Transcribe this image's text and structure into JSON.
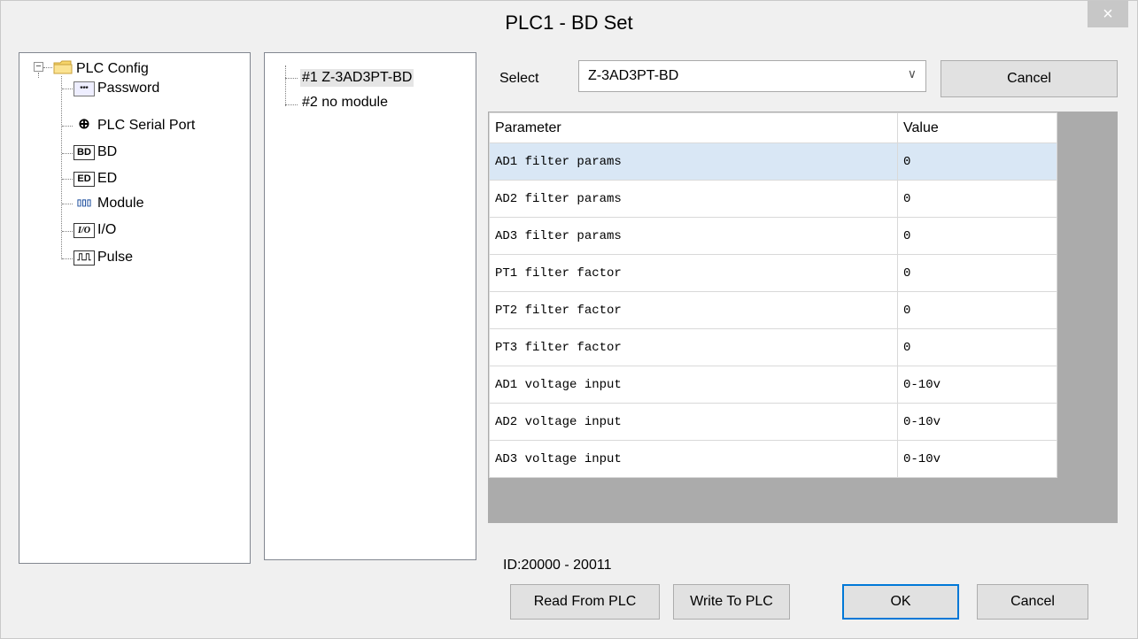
{
  "window": {
    "title": "PLC1 - BD  Set",
    "close_glyph": "×"
  },
  "config_tree": {
    "root": {
      "label": "PLC Config",
      "icon": "folder-icon",
      "expander": "−"
    },
    "items": [
      {
        "label": "Password",
        "icon": "password-icon",
        "icon_text": "***"
      },
      {
        "label": "PLC Serial Port",
        "icon": "serial-port-icon",
        "icon_text": "⊕"
      },
      {
        "label": "BD",
        "icon": "bd-icon",
        "icon_text": "BD"
      },
      {
        "label": "ED",
        "icon": "ed-icon",
        "icon_text": "ED"
      },
      {
        "label": "Module",
        "icon": "module-icon",
        "icon_text": "▯▯▯"
      },
      {
        "label": "I/O",
        "icon": "io-icon",
        "icon_text": "I/O"
      },
      {
        "label": "Pulse",
        "icon": "pulse-icon",
        "icon_text": "⎍⎍"
      }
    ]
  },
  "slot_list": {
    "items": [
      {
        "label": "#1 Z-3AD3PT-BD",
        "selected": true
      },
      {
        "label": "#2 no module",
        "selected": false
      }
    ]
  },
  "module_select": {
    "label": "Select",
    "value": "Z-3AD3PT-BD",
    "arrow": "∨",
    "cancel_label": "Cancel"
  },
  "param_table": {
    "headers": [
      "Parameter",
      "Value"
    ],
    "rows": [
      {
        "param": "AD1 filter params",
        "value": "0"
      },
      {
        "param": "AD2 filter params",
        "value": "0"
      },
      {
        "param": "AD3 filter params",
        "value": "0"
      },
      {
        "param": "PT1 filter factor",
        "value": "0"
      },
      {
        "param": "PT2 filter factor",
        "value": "0"
      },
      {
        "param": "PT3 filter factor",
        "value": "0"
      },
      {
        "param": "AD1 voltage input",
        "value": "0-10v"
      },
      {
        "param": "AD2 voltage input",
        "value": "0-10v"
      },
      {
        "param": "AD3 voltage input",
        "value": "0-10v"
      }
    ],
    "selected_row": 0
  },
  "id_range": "ID:20000 - 20011",
  "footer": {
    "read_label": "Read From PLC",
    "write_label": "Write To PLC",
    "ok_label": "OK",
    "cancel_label": "Cancel"
  },
  "colors": {
    "selection": "#d9e7f5",
    "grid_background": "#ababab",
    "default_button_border": "#0078d7"
  }
}
